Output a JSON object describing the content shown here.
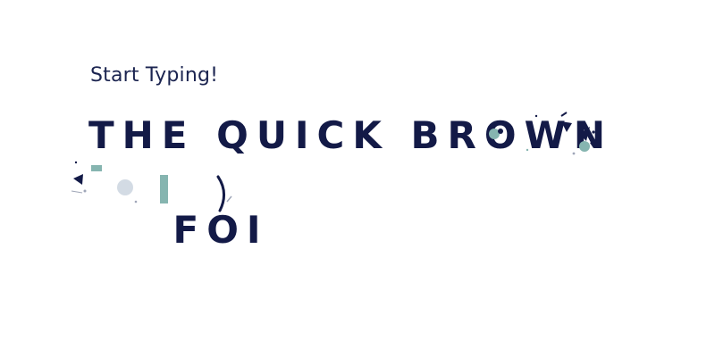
{
  "prompt": {
    "text": "Start Typing!"
  },
  "typed": {
    "line1": "THE QUICK BROWN",
    "line2": "FOI"
  },
  "colors": {
    "text": "#131a47",
    "accent": "#86b5b0",
    "background": "#ffffff"
  },
  "icons": {
    "caret": "text-cursor-icon",
    "particles": "ink-splatter-decoration"
  }
}
